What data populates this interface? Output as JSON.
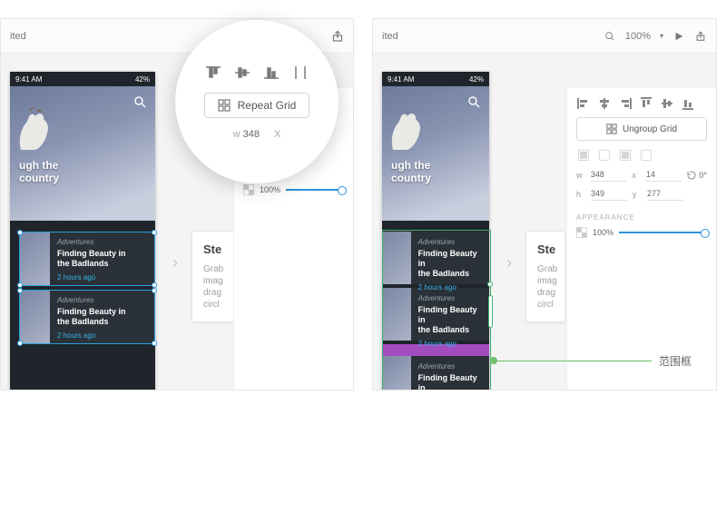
{
  "toolbar": {
    "doc_status": "ited",
    "zoom_label": "100%"
  },
  "phone": {
    "time": "9:41 AM",
    "battery": "42%",
    "hero_line1": "ugh the",
    "hero_line2": "country"
  },
  "card": {
    "category": "Adventures",
    "title1": "Finding Beauty in",
    "title2": "the Badlands",
    "time": "2 hours ago"
  },
  "info": {
    "title": "Ste",
    "body1": "Grab",
    "body2": "imag",
    "body3": "drag",
    "body4": "circl"
  },
  "repeat_grid_label": "Repeat Grid",
  "ungroup_grid_label": "Ungroup Grid",
  "w_label": "w",
  "w_value": "348",
  "x_label": "x",
  "x_value": "14",
  "h_label": "H",
  "h_value": "349",
  "y_label": "Y",
  "y_value": "277",
  "rotation": "0°",
  "appearance": "APPEARANCE",
  "opacity": "100%",
  "magnifier_w": "348",
  "magnifier_x_label": "X",
  "annotation": "范围框"
}
